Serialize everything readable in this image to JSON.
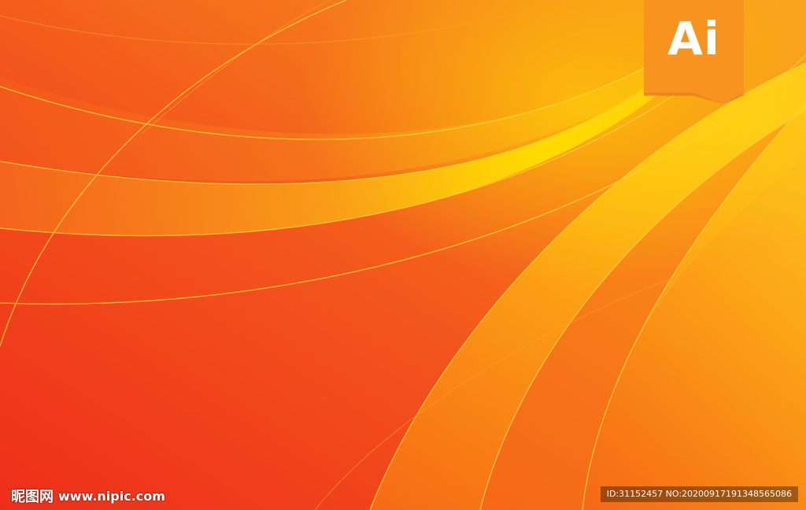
{
  "badge": {
    "label": "Ai",
    "icon": "adobe-illustrator-logo",
    "color": "#F7931E"
  },
  "watermark": {
    "brand_cn": "昵图网",
    "site": "www.nipic.com",
    "id_text": "ID:31152457 NO:20200917191348565086"
  },
  "colors": {
    "base_red": "#F03A1C",
    "orange": "#F77A1A",
    "yellow": "#FFD400"
  }
}
